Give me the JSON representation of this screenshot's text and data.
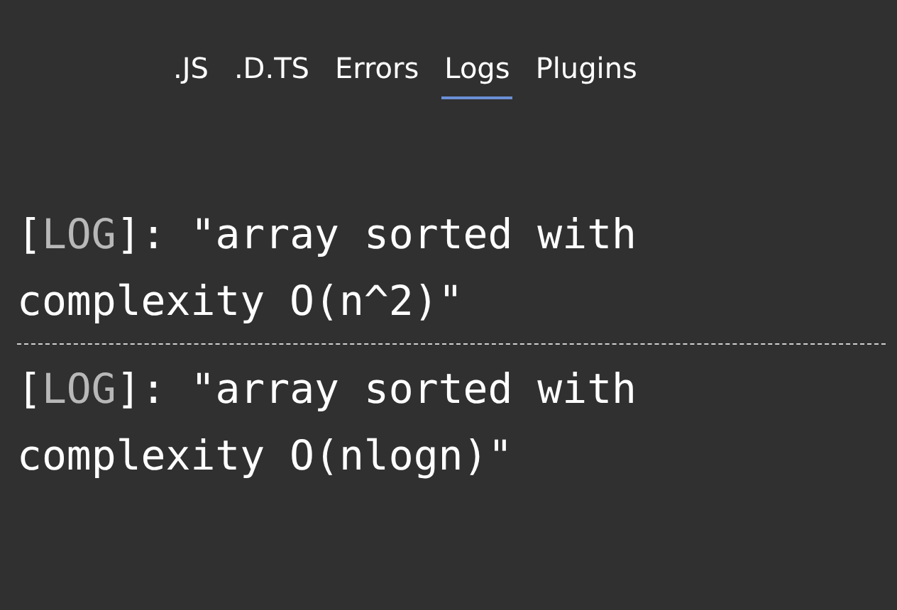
{
  "tabs": [
    {
      "label": ".JS",
      "selected": false
    },
    {
      "label": ".D.TS",
      "selected": false
    },
    {
      "label": "Errors",
      "selected": false
    },
    {
      "label": "Logs",
      "selected": true
    },
    {
      "label": "Plugins",
      "selected": false
    }
  ],
  "logs": [
    {
      "bracket_open": "[",
      "level": "LOG",
      "bracket_close": "]:",
      "message": "\"array sorted with complexity O(n^2)\""
    },
    {
      "bracket_open": "[",
      "level": "LOG",
      "bracket_close": "]:",
      "message": "\"array sorted with complexity O(nlogn)\""
    }
  ]
}
